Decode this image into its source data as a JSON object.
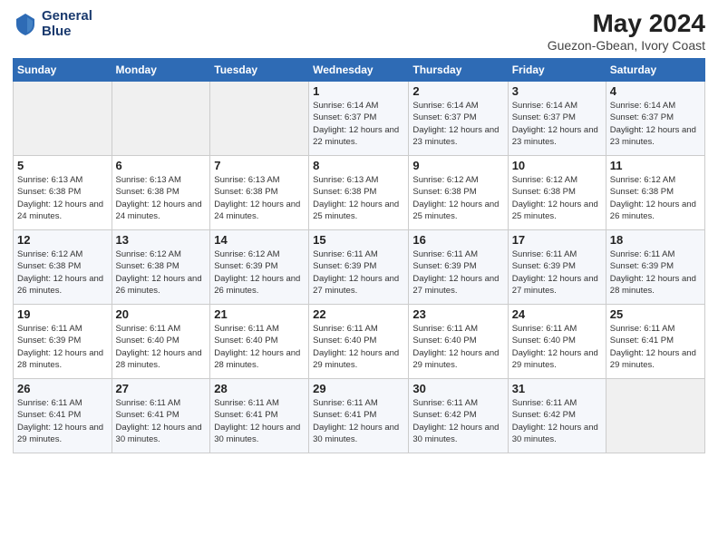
{
  "logo": {
    "line1": "General",
    "line2": "Blue"
  },
  "title": "May 2024",
  "subtitle": "Guezon-Gbean, Ivory Coast",
  "days_header": [
    "Sunday",
    "Monday",
    "Tuesday",
    "Wednesday",
    "Thursday",
    "Friday",
    "Saturday"
  ],
  "weeks": [
    [
      {
        "num": "",
        "info": ""
      },
      {
        "num": "",
        "info": ""
      },
      {
        "num": "",
        "info": ""
      },
      {
        "num": "1",
        "info": "Sunrise: 6:14 AM\nSunset: 6:37 PM\nDaylight: 12 hours\nand 22 minutes."
      },
      {
        "num": "2",
        "info": "Sunrise: 6:14 AM\nSunset: 6:37 PM\nDaylight: 12 hours\nand 23 minutes."
      },
      {
        "num": "3",
        "info": "Sunrise: 6:14 AM\nSunset: 6:37 PM\nDaylight: 12 hours\nand 23 minutes."
      },
      {
        "num": "4",
        "info": "Sunrise: 6:14 AM\nSunset: 6:37 PM\nDaylight: 12 hours\nand 23 minutes."
      }
    ],
    [
      {
        "num": "5",
        "info": "Sunrise: 6:13 AM\nSunset: 6:38 PM\nDaylight: 12 hours\nand 24 minutes."
      },
      {
        "num": "6",
        "info": "Sunrise: 6:13 AM\nSunset: 6:38 PM\nDaylight: 12 hours\nand 24 minutes."
      },
      {
        "num": "7",
        "info": "Sunrise: 6:13 AM\nSunset: 6:38 PM\nDaylight: 12 hours\nand 24 minutes."
      },
      {
        "num": "8",
        "info": "Sunrise: 6:13 AM\nSunset: 6:38 PM\nDaylight: 12 hours\nand 25 minutes."
      },
      {
        "num": "9",
        "info": "Sunrise: 6:12 AM\nSunset: 6:38 PM\nDaylight: 12 hours\nand 25 minutes."
      },
      {
        "num": "10",
        "info": "Sunrise: 6:12 AM\nSunset: 6:38 PM\nDaylight: 12 hours\nand 25 minutes."
      },
      {
        "num": "11",
        "info": "Sunrise: 6:12 AM\nSunset: 6:38 PM\nDaylight: 12 hours\nand 26 minutes."
      }
    ],
    [
      {
        "num": "12",
        "info": "Sunrise: 6:12 AM\nSunset: 6:38 PM\nDaylight: 12 hours\nand 26 minutes."
      },
      {
        "num": "13",
        "info": "Sunrise: 6:12 AM\nSunset: 6:38 PM\nDaylight: 12 hours\nand 26 minutes."
      },
      {
        "num": "14",
        "info": "Sunrise: 6:12 AM\nSunset: 6:39 PM\nDaylight: 12 hours\nand 26 minutes."
      },
      {
        "num": "15",
        "info": "Sunrise: 6:11 AM\nSunset: 6:39 PM\nDaylight: 12 hours\nand 27 minutes."
      },
      {
        "num": "16",
        "info": "Sunrise: 6:11 AM\nSunset: 6:39 PM\nDaylight: 12 hours\nand 27 minutes."
      },
      {
        "num": "17",
        "info": "Sunrise: 6:11 AM\nSunset: 6:39 PM\nDaylight: 12 hours\nand 27 minutes."
      },
      {
        "num": "18",
        "info": "Sunrise: 6:11 AM\nSunset: 6:39 PM\nDaylight: 12 hours\nand 28 minutes."
      }
    ],
    [
      {
        "num": "19",
        "info": "Sunrise: 6:11 AM\nSunset: 6:39 PM\nDaylight: 12 hours\nand 28 minutes."
      },
      {
        "num": "20",
        "info": "Sunrise: 6:11 AM\nSunset: 6:40 PM\nDaylight: 12 hours\nand 28 minutes."
      },
      {
        "num": "21",
        "info": "Sunrise: 6:11 AM\nSunset: 6:40 PM\nDaylight: 12 hours\nand 28 minutes."
      },
      {
        "num": "22",
        "info": "Sunrise: 6:11 AM\nSunset: 6:40 PM\nDaylight: 12 hours\nand 29 minutes."
      },
      {
        "num": "23",
        "info": "Sunrise: 6:11 AM\nSunset: 6:40 PM\nDaylight: 12 hours\nand 29 minutes."
      },
      {
        "num": "24",
        "info": "Sunrise: 6:11 AM\nSunset: 6:40 PM\nDaylight: 12 hours\nand 29 minutes."
      },
      {
        "num": "25",
        "info": "Sunrise: 6:11 AM\nSunset: 6:41 PM\nDaylight: 12 hours\nand 29 minutes."
      }
    ],
    [
      {
        "num": "26",
        "info": "Sunrise: 6:11 AM\nSunset: 6:41 PM\nDaylight: 12 hours\nand 29 minutes."
      },
      {
        "num": "27",
        "info": "Sunrise: 6:11 AM\nSunset: 6:41 PM\nDaylight: 12 hours\nand 30 minutes."
      },
      {
        "num": "28",
        "info": "Sunrise: 6:11 AM\nSunset: 6:41 PM\nDaylight: 12 hours\nand 30 minutes."
      },
      {
        "num": "29",
        "info": "Sunrise: 6:11 AM\nSunset: 6:41 PM\nDaylight: 12 hours\nand 30 minutes."
      },
      {
        "num": "30",
        "info": "Sunrise: 6:11 AM\nSunset: 6:42 PM\nDaylight: 12 hours\nand 30 minutes."
      },
      {
        "num": "31",
        "info": "Sunrise: 6:11 AM\nSunset: 6:42 PM\nDaylight: 12 hours\nand 30 minutes."
      },
      {
        "num": "",
        "info": ""
      }
    ]
  ]
}
